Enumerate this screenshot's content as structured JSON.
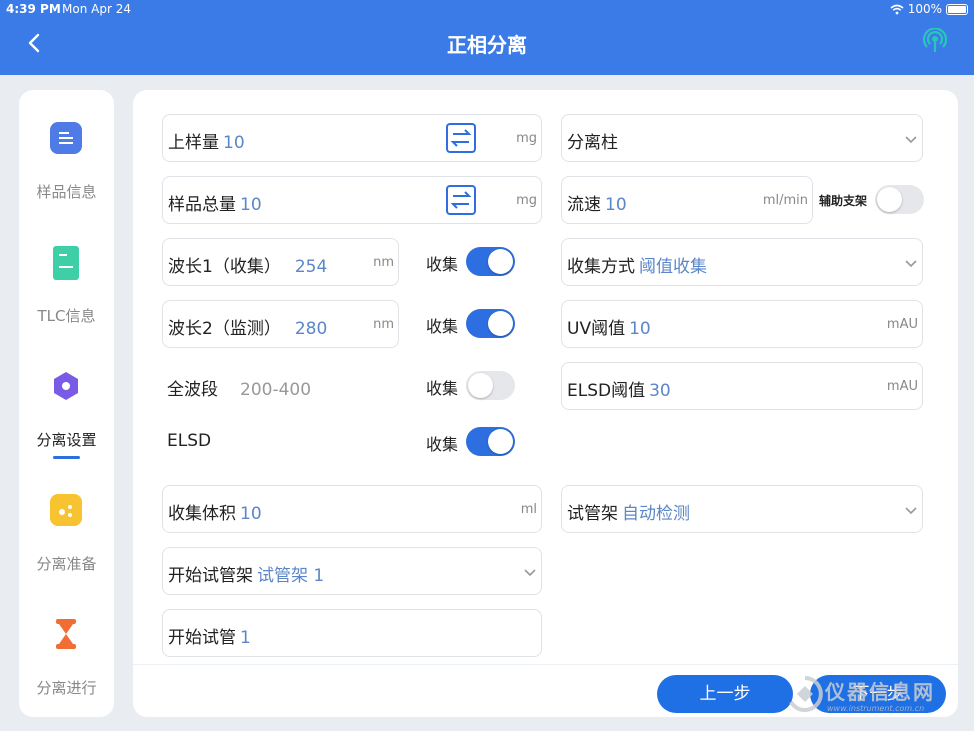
{
  "status_bar": {
    "time": "4:39 PM",
    "date": "Mon Apr 24",
    "battery": "100%"
  },
  "header": {
    "title": "正相分离"
  },
  "colors": {
    "primary": "#3a7be8",
    "accent": "#2d6fe0",
    "value": "#5b86c7"
  },
  "sidebar": {
    "items": [
      {
        "label": "样品信息",
        "icon": "document-icon"
      },
      {
        "label": "TLC信息",
        "icon": "tlc-plate-icon"
      },
      {
        "label": "分离设置",
        "icon": "settings-gear-icon",
        "active": true
      },
      {
        "label": "分离准备",
        "icon": "prepare-icon"
      },
      {
        "label": "分离进行",
        "icon": "hourglass-icon"
      }
    ]
  },
  "form": {
    "load_amount": {
      "label": "上样量",
      "value": "10",
      "unit": "mg"
    },
    "column": {
      "label": "分离柱"
    },
    "total_sample": {
      "label": "样品总量",
      "value": "10",
      "unit": "mg"
    },
    "flow_rate": {
      "label": "流速",
      "value": "10",
      "unit": "ml/min"
    },
    "aux_rack": {
      "label": "辅助支架",
      "on": false
    },
    "wavelength1": {
      "label": "波长1（收集）",
      "value": "254",
      "unit": "nm",
      "collect_label": "收集",
      "collect": true
    },
    "collect_mode": {
      "label": "收集方式",
      "value": "阈值收集"
    },
    "wavelength2": {
      "label": "波长2（监测）",
      "value": "280",
      "unit": "nm",
      "collect_label": "收集",
      "collect": true
    },
    "uv_threshold": {
      "label": "UV阈值",
      "value": "10",
      "unit": "mAU"
    },
    "full_band": {
      "label": "全波段",
      "value": "200-400",
      "collect_label": "收集",
      "collect": false
    },
    "elsd_threshold": {
      "label": "ELSD阈值",
      "value": "30",
      "unit": "mAU"
    },
    "elsd": {
      "label": "ELSD",
      "collect_label": "收集",
      "collect": true
    },
    "collect_volume": {
      "label": "收集体积",
      "value": "10",
      "unit": "ml"
    },
    "tube_rack": {
      "label": "试管架",
      "value": "自动检测"
    },
    "start_rack": {
      "label": "开始试管架",
      "value": "试管架 1"
    },
    "start_tube": {
      "label": "开始试管",
      "value": "1"
    }
  },
  "footer": {
    "prev_label": "上一步",
    "next_label": "下一步"
  },
  "watermark": {
    "text": "仪器信息网",
    "url": "www.instrument.com.cn"
  }
}
